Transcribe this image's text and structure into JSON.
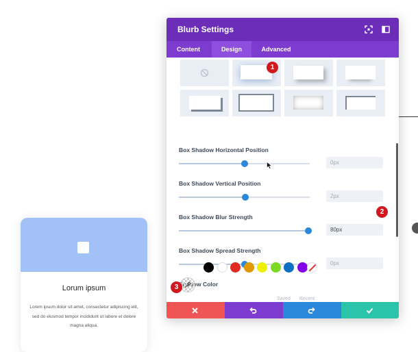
{
  "card": {
    "title": "Lorum ipsum",
    "body": "Lorem ipsum dolor sit amet, consectetur adipiscing elit, sed do eiusmod tempor incididunt ut labore et dolore magna aliqua.",
    "header_color": "#a2c2f7",
    "icon": "square-icon"
  },
  "panel": {
    "title": "Blurb Settings",
    "header_icons": [
      "expand-icon",
      "sidebar-icon"
    ],
    "tabs": [
      {
        "label": "Content",
        "active": false
      },
      {
        "label": "Design",
        "active": true
      },
      {
        "label": "Advanced",
        "active": false
      }
    ],
    "shadow_presets": [
      "none",
      "preset-1",
      "preset-2",
      "preset-3",
      "preset-4",
      "preset-5",
      "preset-6",
      "preset-7"
    ],
    "selected_preset": "preset-1",
    "fields": [
      {
        "label": "Box Shadow Horizontal Position",
        "value": "0px",
        "slider": 0.5
      },
      {
        "label": "Box Shadow Vertical Position",
        "value": "2px",
        "slider": 0.51
      },
      {
        "label": "Box Shadow Blur Strength",
        "value": "80px",
        "slider": 0.99
      },
      {
        "label": "Box Shadow Spread Strength",
        "value": "0px",
        "slider": 0.5
      }
    ],
    "shadow_color_label": "Shadow Color",
    "swatches": [
      "#000000",
      "#ffffff",
      "#e02b20",
      "#e09900",
      "#edf000",
      "#7cda24",
      "#0c71c3",
      "#8300e9"
    ],
    "saved_label": "Saved",
    "recent_label": "Recent",
    "footer": {
      "cancel_icon": "x-icon",
      "undo_icon": "undo-icon",
      "redo_icon": "redo-icon",
      "save_icon": "check-icon",
      "colors": [
        "#ef5555",
        "#7e3bd0",
        "#2b87da",
        "#29c4a9"
      ]
    },
    "colors": {
      "header": "#6c2eb9",
      "tabs": "#7e3bd0",
      "accent": "#2b87da"
    }
  },
  "badges": [
    "1",
    "2",
    "3"
  ]
}
